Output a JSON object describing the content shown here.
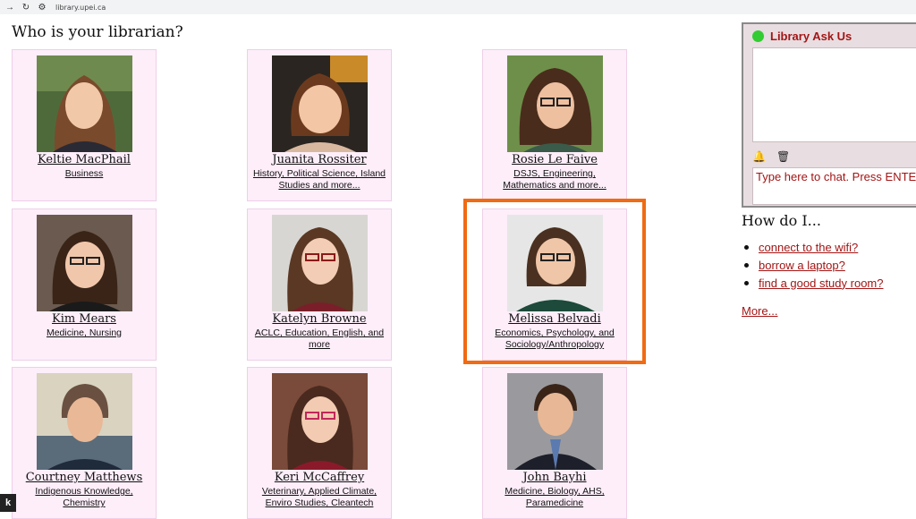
{
  "browser": {
    "url": "library.upei.ca"
  },
  "page": {
    "title": "Who is your librarian?"
  },
  "librarians": [
    {
      "name": "Keltie MacPhail",
      "subject": "Business",
      "photo": "keltie"
    },
    {
      "name": "Juanita Rossiter",
      "subject": "History, Political Science, Island Studies and more...",
      "photo": "juanita"
    },
    {
      "name": "Rosie Le Faive",
      "subject": "DSJS, Engineering, Mathematics and more...",
      "photo": "rosie"
    },
    {
      "name": "Kim Mears",
      "subject": "Medicine, Nursing",
      "photo": "kim"
    },
    {
      "name": "Katelyn Browne",
      "subject": "ACLC, Education, English, and more",
      "photo": "katelyn"
    },
    {
      "name": "Melissa Belvadi",
      "subject": "Economics, Psychology, and Sociology/Anthropology",
      "photo": "melissa"
    },
    {
      "name": "Courtney Matthews",
      "subject": "Indigenous Knowledge, Chemistry",
      "photo": "courtney"
    },
    {
      "name": "Keri McCaffrey",
      "subject": "Veterinary, Applied Climate, Enviro Studies, Cleantech",
      "photo": "keri"
    },
    {
      "name": "John Bayhi",
      "subject": "Medicine, Biology, AHS, Paramedicine",
      "photo": "john"
    }
  ],
  "chat": {
    "title": "Library Ask Us",
    "input_placeholder": "Type here to chat. Press ENTER to send.",
    "status_color": "#33cc33"
  },
  "howdo": {
    "title": "How do I...",
    "items": [
      "connect to the wifi?",
      "borrow a laptop?",
      "find a good study room?"
    ],
    "more": "More..."
  },
  "corner_tab": "k",
  "colors": {
    "accent": "#a31515",
    "highlight": "#f06b13",
    "card_bg": "#fdeefa"
  }
}
